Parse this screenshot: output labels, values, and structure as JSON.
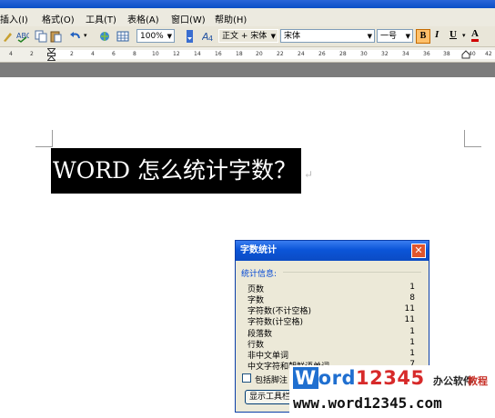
{
  "menu": {
    "items": [
      "插入(I)",
      "格式(O)",
      "工具(T)",
      "表格(A)",
      "窗口(W)",
      "帮助(H)"
    ]
  },
  "toolbar": {
    "zoom": "100%",
    "style_value": "正文 + 宋体",
    "font_value": "宋体",
    "size_value": "一号",
    "bold": "B",
    "italic": "I",
    "underline": "U",
    "font_color": "A"
  },
  "ruler": {
    "ticks": [
      "4",
      "2",
      "2",
      "4",
      "6",
      "8",
      "10",
      "12",
      "14",
      "16",
      "18",
      "20",
      "22",
      "24",
      "26",
      "28",
      "30",
      "32",
      "34",
      "36",
      "38",
      "40",
      "42"
    ]
  },
  "document": {
    "selected_text": "WORD 怎么统计字数？"
  },
  "dialog": {
    "title": "字数统计",
    "group_label": "统计信息:",
    "rows": [
      {
        "label": "页数",
        "value": "1"
      },
      {
        "label": "字数",
        "value": "8"
      },
      {
        "label": "字符数(不计空格)",
        "value": "11"
      },
      {
        "label": "字符数(计空格)",
        "value": "11"
      },
      {
        "label": "段落数",
        "value": "1"
      },
      {
        "label": "行数",
        "value": "1"
      },
      {
        "label": "非中文单词",
        "value": "1"
      },
      {
        "label": "中文字符和朝鲜语单词",
        "value": "7"
      }
    ],
    "checkbox_label": "包括脚注",
    "button_label": "显示工具栏"
  },
  "watermark": {
    "logo_w": "W",
    "logo_ord": "ord",
    "logo_num": "12345",
    "tag1": "办公软件",
    "tag2": "教程",
    "url": "www.word12345.com"
  },
  "colors": {
    "dialog_title": "#0b55d8",
    "selection": "#000000",
    "watermark_blue": "#1f6fd0",
    "watermark_red": "#d72a2a"
  }
}
